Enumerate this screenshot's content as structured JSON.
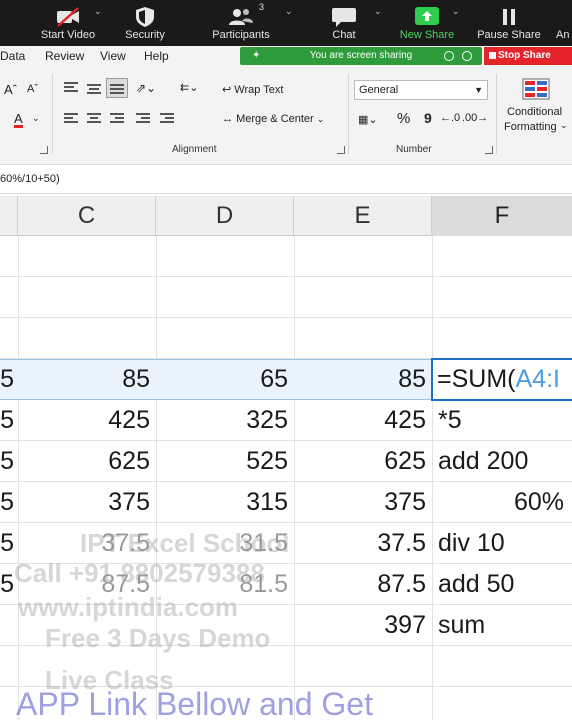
{
  "zoom_toolbar": {
    "items": [
      {
        "label": "Start Video",
        "icon": "video-off-icon"
      },
      {
        "label": "Security",
        "icon": "shield-icon"
      },
      {
        "label": "Participants",
        "icon": "participants-icon",
        "count": "3"
      },
      {
        "label": "Chat",
        "icon": "chat-icon"
      },
      {
        "label": "New Share",
        "icon": "share-arrow-icon",
        "color": "#2ecc4f"
      },
      {
        "label": "Pause Share",
        "icon": "pause-icon"
      },
      {
        "label": "An",
        "icon": ""
      }
    ]
  },
  "ribbon": {
    "tabs": [
      "Data",
      "Review",
      "View",
      "Help"
    ],
    "share_status": "You are screen sharing",
    "stop_share": "Stop Share",
    "buttons": {
      "wrap_text": "Wrap Text",
      "merge_center": "Merge & Center",
      "number_format": "General",
      "conditional_formatting_1": "Conditional",
      "conditional_formatting_2": "Formatting",
      "percent": "%",
      "comma": "9"
    },
    "groups": {
      "alignment": "Alignment",
      "number": "Number"
    }
  },
  "formula_bar": {
    "text": "60%/10+50)"
  },
  "columns": [
    {
      "letter": "C"
    },
    {
      "letter": "D"
    },
    {
      "letter": "E"
    },
    {
      "letter": "F"
    }
  ],
  "rows": [
    {
      "b": "",
      "c": "",
      "d": "",
      "e": "",
      "f": ""
    },
    {
      "b": "",
      "c": "",
      "d": "",
      "e": "",
      "f": ""
    },
    {
      "b": "",
      "c": "",
      "d": "",
      "e": "",
      "f": ""
    },
    {
      "b": "5",
      "c": "85",
      "d": "65",
      "e": "85",
      "f": "=SUM(",
      "f_ref": "A4:I"
    },
    {
      "b": "5",
      "c": "425",
      "d": "325",
      "e": "425",
      "f": "*5"
    },
    {
      "b": "5",
      "c": "625",
      "d": "525",
      "e": "625",
      "f": "add 200"
    },
    {
      "b": "5",
      "c": "375",
      "d": "315",
      "e": "375",
      "f_right": "60%"
    },
    {
      "b": "5",
      "c": "37.5",
      "d": "31.5",
      "e": "37.5",
      "f": "div 10"
    },
    {
      "b": "5",
      "c": "87.5",
      "d": "81.5",
      "e": "87.5",
      "f": "add 50"
    },
    {
      "b": "",
      "c": "",
      "d": "",
      "e": "397",
      "f": "sum"
    },
    {
      "b": "",
      "c": "",
      "d": "",
      "e": "",
      "f": ""
    }
  ],
  "watermark": {
    "line1": "IPT Excel School",
    "line2": "Call +91 8802579388",
    "line3": "www.iptindia.com",
    "line4": "Free 3 Days Demo",
    "line5": "Live Class",
    "banner": "APP Link Bellow and Get"
  }
}
